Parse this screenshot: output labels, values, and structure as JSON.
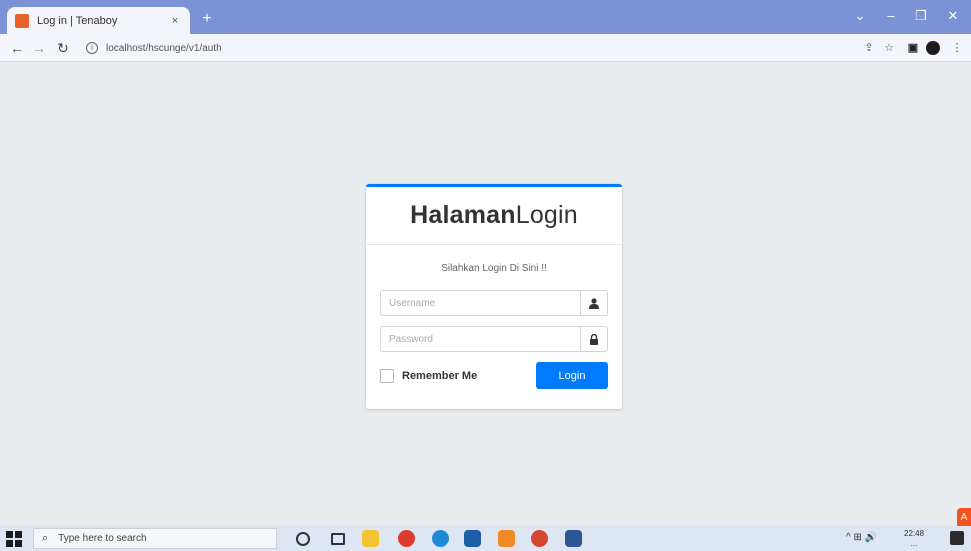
{
  "browser": {
    "tab_title": "Log in | Tenaboy",
    "tab_close": "×",
    "new_tab": "+",
    "url": "localhost/hscunge/v1/auth",
    "window_controls": [
      "⌄",
      "–",
      "❐",
      "✕"
    ],
    "icons": [
      "back-icon",
      "forward-icon",
      "reload-icon",
      "info-icon",
      "share-icon",
      "star-icon",
      "extension-icon",
      "profile-icon",
      "menu-icon"
    ]
  },
  "login": {
    "title_bold": "Halaman",
    "title_regular": "Login",
    "message": "Silahkan Login Di Sini !!",
    "username_placeholder": "Username",
    "password_placeholder": "Password",
    "remember_label": "Remember Me",
    "login_button": "Login",
    "colors": {
      "primary": "#007bff",
      "background": "#e9ecef"
    }
  },
  "taskbar": {
    "search_placeholder": "Type here to search",
    "clock_time": "22:48",
    "clock_date": "...",
    "tray_text": "^ ⊞ 🔊",
    "apps": [
      "cortana-icon",
      "task-view-icon",
      "file-explorer-icon",
      "chrome-icon",
      "edge-icon",
      "store-icon",
      "app-icon",
      "chrome-alt-icon",
      "word-icon"
    ]
  }
}
